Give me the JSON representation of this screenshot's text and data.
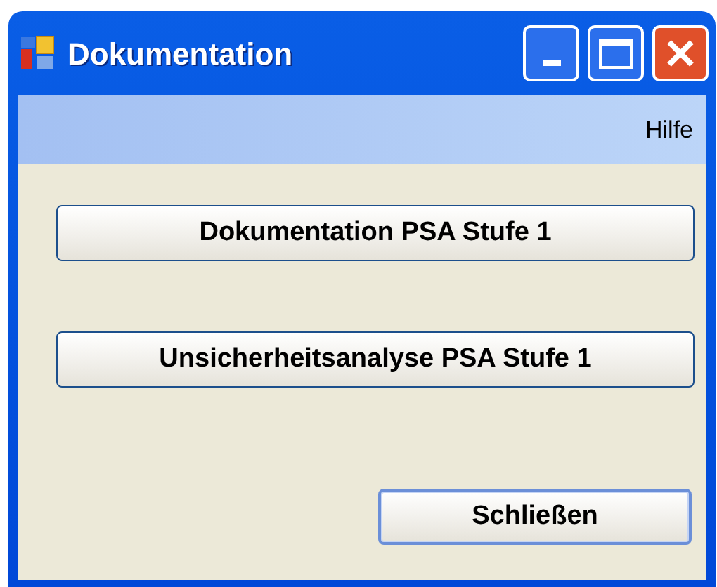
{
  "window": {
    "title": "Dokumentation"
  },
  "menu": [
    {
      "label": "Hilfe"
    }
  ],
  "buttons": [
    {
      "label": "Dokumentation PSA Stufe 1",
      "default": false
    },
    {
      "label": "Unsicherheitsanalyse PSA Stufe 1",
      "default": false
    },
    {
      "label": "Schließen",
      "default": true
    }
  ]
}
